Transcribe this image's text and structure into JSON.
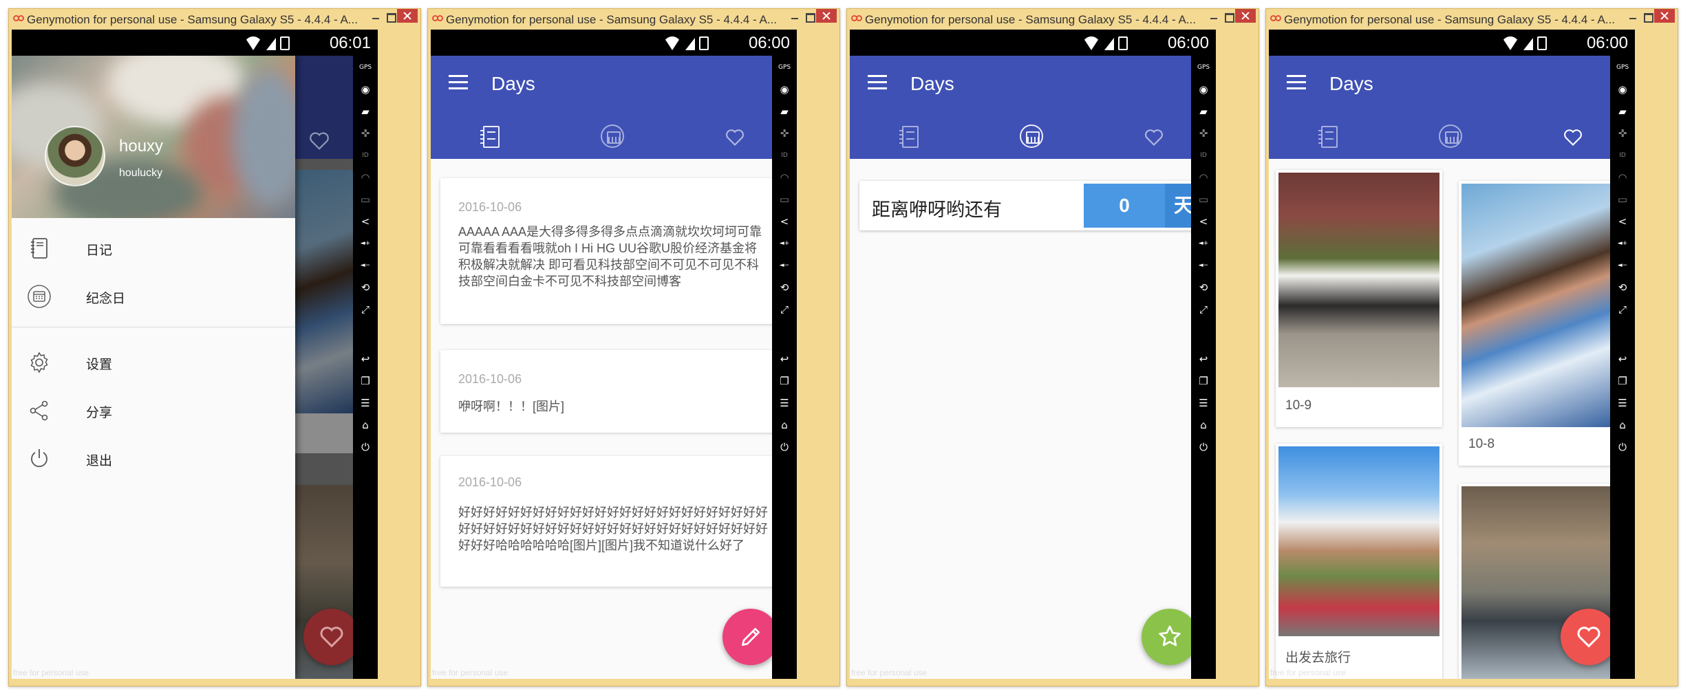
{
  "window": {
    "title": "Genymotion for personal use - Samsung Galaxy S5 - 4.4.4 - A...",
    "watermark": "free for personal use"
  },
  "colors": {
    "primary": "#3f51b5",
    "fab_pink": "#ec407a",
    "fab_green": "#8bc34a",
    "fab_red": "#ef5350",
    "countdown_blue": "#4a98e4"
  },
  "screens": [
    {
      "time": "06:01",
      "drawer": {
        "username": "houxy",
        "email": "houlucky",
        "items": [
          {
            "label": "日记",
            "icon": "notebook-icon"
          },
          {
            "label": "纪念日",
            "icon": "calendar-icon"
          },
          {
            "label": "设置",
            "icon": "gear-icon"
          },
          {
            "label": "分享",
            "icon": "share-icon"
          },
          {
            "label": "退出",
            "icon": "power-icon"
          }
        ]
      },
      "fab_icon": "heart-icon"
    },
    {
      "time": "06:00",
      "title": "Days",
      "active_tab": 0,
      "diary": [
        {
          "date": "2016-10-06",
          "text": "AAAAA AAA是大得多得多得多点点滴滴就坎坎坷坷可靠可靠看看看看哦就oh I Hi HG UU谷歌U股价经济基金将积极解决就解决 即可看见科技部空间不可见不可见不科技部空间白金卡不可见不科技部空间博客"
        },
        {
          "date": "2016-10-06",
          "text": "咿呀啊！！！[图片]"
        },
        {
          "date": "2016-10-06",
          "text": "好好好好好好好好好好好好好好好好好好好好好好好好好好好好好好好好好好好好好好好好好好好好好好好好好好好好好哈哈哈哈哈哈[图片][图片]我不知道说什么好了"
        }
      ],
      "fab_icon": "pencil-icon"
    },
    {
      "time": "06:00",
      "title": "Days",
      "active_tab": 1,
      "countdown": {
        "label": "距离咿呀哟还有",
        "value": "0",
        "unit": "天"
      },
      "fab_icon": "star-icon"
    },
    {
      "time": "06:00",
      "title": "Days",
      "active_tab": 2,
      "photos": [
        {
          "caption": "10-9"
        },
        {
          "caption": "10-8"
        },
        {
          "caption": "出发去旅行"
        },
        {
          "caption": ""
        }
      ],
      "fab_icon": "heart-icon"
    }
  ]
}
